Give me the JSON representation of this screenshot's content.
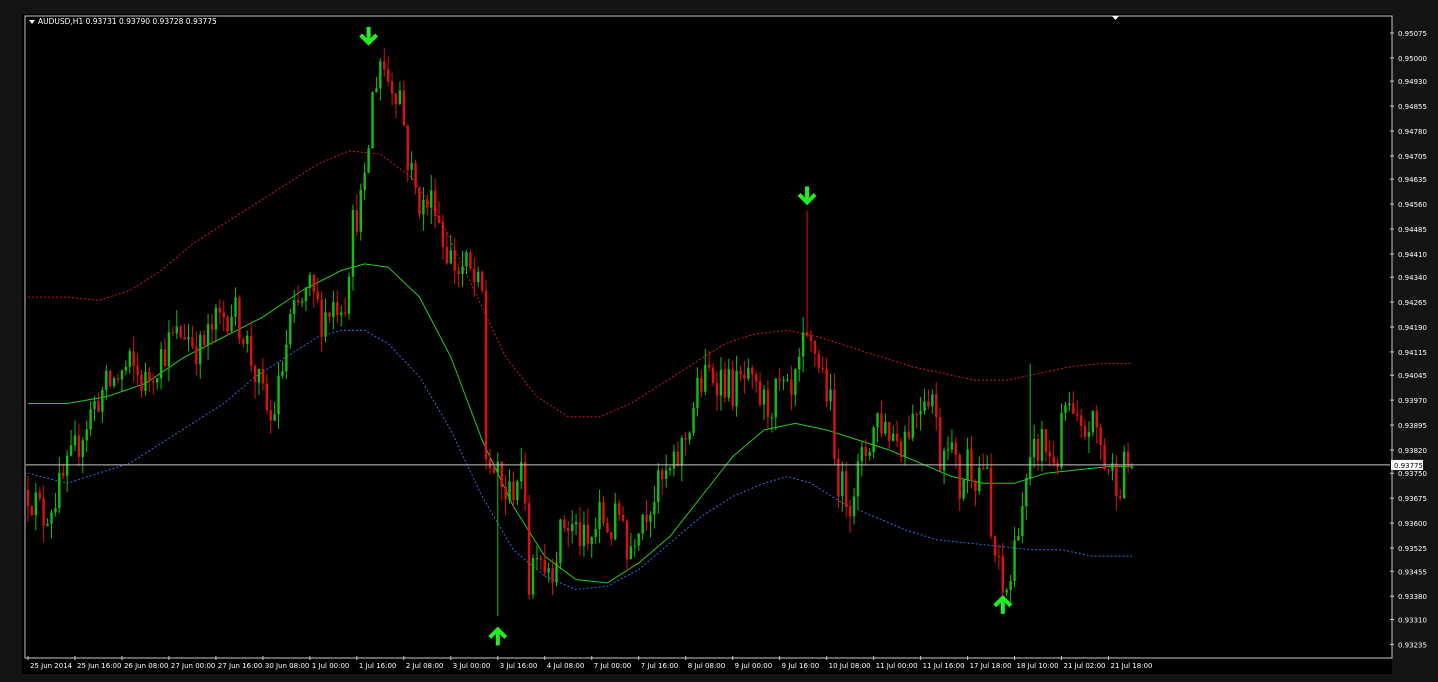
{
  "chart_data": {
    "type": "candlestick",
    "symbol_header": "AUDUSD,H1  0.93731 0.93790 0.93728 0.93775",
    "current_price": 0.93775,
    "current_price_label": "0.93775",
    "ylim": [
      0.932,
      0.9512
    ],
    "y_ticks": [
      "0.95075",
      "0.95000",
      "0.94930",
      "0.94855",
      "0.94780",
      "0.94705",
      "0.94635",
      "0.94560",
      "0.94485",
      "0.94410",
      "0.94340",
      "0.94265",
      "0.94190",
      "0.94115",
      "0.94045",
      "0.93970",
      "0.93895",
      "0.93820",
      "0.93750",
      "0.93675",
      "0.93600",
      "0.93525",
      "0.93455",
      "0.93380",
      "0.93310",
      "0.93235"
    ],
    "x_ticks": [
      {
        "label": "25 Jun 2014",
        "idx": 0
      },
      {
        "label": "25 Jun 16:00",
        "idx": 12
      },
      {
        "label": "26 Jun 08:00",
        "idx": 24
      },
      {
        "label": "27 Jun 00:00",
        "idx": 36
      },
      {
        "label": "27 Jun 16:00",
        "idx": 48
      },
      {
        "label": "30 Jun 08:00",
        "idx": 60
      },
      {
        "label": "1 Jul 00:00",
        "idx": 72
      },
      {
        "label": "1 Jul 16:00",
        "idx": 84
      },
      {
        "label": "2 Jul 08:00",
        "idx": 96
      },
      {
        "label": "3 Jul 00:00",
        "idx": 108
      },
      {
        "label": "3 Jul 16:00",
        "idx": 120
      },
      {
        "label": "4 Jul 08:00",
        "idx": 132
      },
      {
        "label": "7 Jul 00:00",
        "idx": 144
      },
      {
        "label": "7 Jul 16:00",
        "idx": 156
      },
      {
        "label": "8 Jul 08:00",
        "idx": 168
      },
      {
        "label": "9 Jul 00:00",
        "idx": 180
      },
      {
        "label": "9 Jul 16:00",
        "idx": 192
      },
      {
        "label": "10 Jul 08:00",
        "idx": 204
      },
      {
        "label": "11 Jul 00:00",
        "idx": 216
      },
      {
        "label": "11 Jul 16:00",
        "idx": 228
      },
      {
        "label": "17 Jul 18:00",
        "idx": 240
      },
      {
        "label": "18 Jul 10:00",
        "idx": 252
      },
      {
        "label": "21 Jul 02:00",
        "idx": 264
      },
      {
        "label": "21 Jul 18:00",
        "idx": 276
      }
    ],
    "close_anchors": [
      [
        0,
        0.937
      ],
      [
        4,
        0.9362
      ],
      [
        6,
        0.9366
      ],
      [
        8,
        0.937
      ],
      [
        11,
        0.9378
      ],
      [
        14,
        0.9388
      ],
      [
        18,
        0.9398
      ],
      [
        22,
        0.9403
      ],
      [
        26,
        0.9407
      ],
      [
        30,
        0.9402
      ],
      [
        33,
        0.9409
      ],
      [
        36,
        0.9414
      ],
      [
        40,
        0.9418
      ],
      [
        44,
        0.9412
      ],
      [
        48,
        0.942
      ],
      [
        52,
        0.9425
      ],
      [
        55,
        0.9418
      ],
      [
        58,
        0.9405
      ],
      [
        62,
        0.939
      ],
      [
        64,
        0.94
      ],
      [
        67,
        0.942
      ],
      [
        72,
        0.943
      ],
      [
        75,
        0.9422
      ],
      [
        78,
        0.9426
      ],
      [
        81,
        0.9428
      ],
      [
        83,
        0.945
      ],
      [
        86,
        0.946
      ],
      [
        88,
        0.9488
      ],
      [
        90,
        0.95
      ],
      [
        92,
        0.9494
      ],
      [
        95,
        0.949
      ],
      [
        97,
        0.947
      ],
      [
        99,
        0.946
      ],
      [
        101,
        0.9455
      ],
      [
        104,
        0.9458
      ],
      [
        106,
        0.9445
      ],
      [
        108,
        0.944
      ],
      [
        110,
        0.9436
      ],
      [
        112,
        0.9437
      ],
      [
        114,
        0.9432
      ],
      [
        116,
        0.9428
      ],
      [
        117,
        0.938
      ],
      [
        119,
        0.9376
      ],
      [
        121,
        0.937
      ],
      [
        123,
        0.9368
      ],
      [
        125,
        0.9375
      ],
      [
        127,
        0.937
      ],
      [
        128,
        0.9342
      ],
      [
        130,
        0.9355
      ],
      [
        132,
        0.9348
      ],
      [
        134,
        0.9348
      ],
      [
        137,
        0.936
      ],
      [
        140,
        0.9358
      ],
      [
        143,
        0.9352
      ],
      [
        146,
        0.9362
      ],
      [
        149,
        0.9358
      ],
      [
        152,
        0.9365
      ],
      [
        153,
        0.935
      ],
      [
        156,
        0.9362
      ],
      [
        159,
        0.9367
      ],
      [
        162,
        0.9372
      ],
      [
        165,
        0.9376
      ],
      [
        168,
        0.9386
      ],
      [
        171,
        0.94
      ],
      [
        174,
        0.9405
      ],
      [
        177,
        0.9404
      ],
      [
        180,
        0.94
      ],
      [
        183,
        0.9403
      ],
      [
        186,
        0.9398
      ],
      [
        189,
        0.9395
      ],
      [
        192,
        0.94
      ],
      [
        195,
        0.9396
      ],
      [
        198,
        0.9412
      ],
      [
        201,
        0.9412
      ],
      [
        203,
        0.9405
      ],
      [
        205,
        0.9395
      ],
      [
        206,
        0.9378
      ],
      [
        208,
        0.937
      ],
      [
        210,
        0.9368
      ],
      [
        212,
        0.9375
      ],
      [
        215,
        0.9385
      ],
      [
        217,
        0.9392
      ],
      [
        220,
        0.9388
      ],
      [
        223,
        0.9385
      ],
      [
        226,
        0.9392
      ],
      [
        229,
        0.94
      ],
      [
        231,
        0.9399
      ],
      [
        233,
        0.938
      ],
      [
        235,
        0.9388
      ],
      [
        238,
        0.937
      ],
      [
        240,
        0.938
      ],
      [
        242,
        0.9375
      ],
      [
        244,
        0.9378
      ],
      [
        245,
        0.9372
      ],
      [
        246,
        0.9355
      ],
      [
        248,
        0.9345
      ],
      [
        249,
        0.9338
      ],
      [
        251,
        0.9343
      ],
      [
        253,
        0.9362
      ],
      [
        255,
        0.937
      ],
      [
        257,
        0.938
      ],
      [
        259,
        0.9385
      ],
      [
        261,
        0.938
      ],
      [
        263,
        0.938
      ],
      [
        265,
        0.9395
      ],
      [
        267,
        0.939
      ],
      [
        269,
        0.9385
      ],
      [
        271,
        0.939
      ],
      [
        273,
        0.9388
      ],
      [
        275,
        0.9378
      ],
      [
        277,
        0.9375
      ],
      [
        279,
        0.9373
      ],
      [
        280,
        0.9377
      ]
    ],
    "spikes": [
      {
        "idx": 90,
        "high": 0.95
      },
      {
        "idx": 199,
        "high": 0.9454
      },
      {
        "idx": 120,
        "low": 0.9332
      },
      {
        "idx": 249,
        "low": 0.9338
      },
      {
        "idx": 256,
        "high": 0.9408
      }
    ],
    "middle_band": [
      [
        0,
        0.9396
      ],
      [
        10,
        0.9396
      ],
      [
        20,
        0.9398
      ],
      [
        30,
        0.9402
      ],
      [
        40,
        0.941
      ],
      [
        50,
        0.9416
      ],
      [
        60,
        0.9422
      ],
      [
        70,
        0.943
      ],
      [
        80,
        0.9436
      ],
      [
        86,
        0.9438
      ],
      [
        92,
        0.9437
      ],
      [
        100,
        0.9428
      ],
      [
        108,
        0.941
      ],
      [
        116,
        0.9385
      ],
      [
        124,
        0.9365
      ],
      [
        132,
        0.935
      ],
      [
        140,
        0.9343
      ],
      [
        148,
        0.9342
      ],
      [
        156,
        0.9348
      ],
      [
        164,
        0.9356
      ],
      [
        172,
        0.9368
      ],
      [
        180,
        0.938
      ],
      [
        188,
        0.9388
      ],
      [
        196,
        0.939
      ],
      [
        204,
        0.9388
      ],
      [
        212,
        0.9385
      ],
      [
        220,
        0.9382
      ],
      [
        228,
        0.9378
      ],
      [
        236,
        0.9374
      ],
      [
        244,
        0.9372
      ],
      [
        252,
        0.9372
      ],
      [
        260,
        0.9375
      ],
      [
        268,
        0.9376
      ],
      [
        276,
        0.9377
      ],
      [
        282,
        0.9377
      ]
    ],
    "upper_band": [
      [
        0,
        0.9428
      ],
      [
        10,
        0.9428
      ],
      [
        18,
        0.9427
      ],
      [
        26,
        0.943
      ],
      [
        34,
        0.9436
      ],
      [
        42,
        0.9444
      ],
      [
        50,
        0.945
      ],
      [
        58,
        0.9456
      ],
      [
        66,
        0.9462
      ],
      [
        74,
        0.9468
      ],
      [
        82,
        0.9472
      ],
      [
        90,
        0.9471
      ],
      [
        98,
        0.9464
      ],
      [
        106,
        0.945
      ],
      [
        114,
        0.943
      ],
      [
        122,
        0.941
      ],
      [
        130,
        0.9398
      ],
      [
        138,
        0.9392
      ],
      [
        146,
        0.9392
      ],
      [
        154,
        0.9396
      ],
      [
        162,
        0.9402
      ],
      [
        170,
        0.9408
      ],
      [
        178,
        0.9414
      ],
      [
        186,
        0.9417
      ],
      [
        194,
        0.9418
      ],
      [
        202,
        0.9416
      ],
      [
        210,
        0.9413
      ],
      [
        218,
        0.941
      ],
      [
        226,
        0.9407
      ],
      [
        234,
        0.9405
      ],
      [
        242,
        0.9403
      ],
      [
        250,
        0.9403
      ],
      [
        258,
        0.9405
      ],
      [
        266,
        0.9407
      ],
      [
        274,
        0.9408
      ],
      [
        282,
        0.9408
      ]
    ],
    "lower_band": [
      [
        0,
        0.9375
      ],
      [
        10,
        0.9372
      ],
      [
        18,
        0.9375
      ],
      [
        26,
        0.9378
      ],
      [
        34,
        0.9384
      ],
      [
        42,
        0.939
      ],
      [
        50,
        0.9396
      ],
      [
        58,
        0.9404
      ],
      [
        66,
        0.941
      ],
      [
        74,
        0.9416
      ],
      [
        80,
        0.9418
      ],
      [
        86,
        0.9418
      ],
      [
        92,
        0.9414
      ],
      [
        100,
        0.9404
      ],
      [
        108,
        0.9388
      ],
      [
        116,
        0.9368
      ],
      [
        124,
        0.9352
      ],
      [
        132,
        0.9344
      ],
      [
        140,
        0.934
      ],
      [
        148,
        0.9341
      ],
      [
        156,
        0.9346
      ],
      [
        164,
        0.9354
      ],
      [
        172,
        0.9362
      ],
      [
        180,
        0.9368
      ],
      [
        188,
        0.9372
      ],
      [
        194,
        0.9374
      ],
      [
        200,
        0.9372
      ],
      [
        208,
        0.9366
      ],
      [
        216,
        0.9362
      ],
      [
        224,
        0.9358
      ],
      [
        232,
        0.9355
      ],
      [
        240,
        0.9354
      ],
      [
        248,
        0.9353
      ],
      [
        256,
        0.9352
      ],
      [
        264,
        0.9352
      ],
      [
        272,
        0.935
      ],
      [
        282,
        0.935
      ]
    ],
    "arrows": [
      {
        "type": "sell",
        "idx": 87,
        "price": 0.95045
      },
      {
        "type": "sell",
        "idx": 199,
        "price": 0.94565
      },
      {
        "type": "buy",
        "idx": 120,
        "price": 0.9328
      },
      {
        "type": "buy",
        "idx": 249,
        "price": 0.93375
      }
    ],
    "colors": {
      "background": "#000000",
      "frame": "#141414",
      "axis": "#c8c8c8",
      "bull": "#10c010",
      "bear": "#e01010",
      "middle_band": "#22cc22",
      "upper_band": "#cc1a1a",
      "lower_band": "#2a6ee8",
      "arrow": "#22ee22",
      "price_line": "#c8c8c8",
      "text": "#ffffff"
    }
  }
}
